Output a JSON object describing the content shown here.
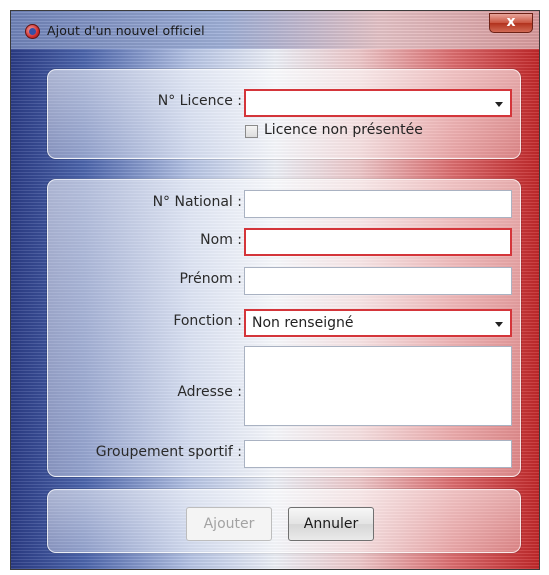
{
  "window": {
    "title": "Ajout d'un nouvel officiel",
    "close_label": "x",
    "accent_colors": {
      "blue": "#2b3c86",
      "red": "#c2282a",
      "error_border": "#d4353a"
    }
  },
  "licence_section": {
    "licence_label": "N° Licence :",
    "licence_value": "",
    "licence_dropdown_icon": "chevron-down-icon",
    "checkbox_label": "Licence non présentée",
    "checkbox_checked": false
  },
  "details_section": {
    "national_label": "N° National :",
    "national_value": "",
    "nom_label": "Nom :",
    "nom_value": "",
    "prenom_label": "Prénom :",
    "prenom_value": "",
    "fonction_label": "Fonction :",
    "fonction_value": "Non renseigné",
    "adresse_label": "Adresse :",
    "adresse_value": "",
    "groupement_label": "Groupement sportif :",
    "groupement_value": ""
  },
  "actions": {
    "add_label": "Ajouter",
    "add_enabled": false,
    "cancel_label": "Annuler"
  }
}
